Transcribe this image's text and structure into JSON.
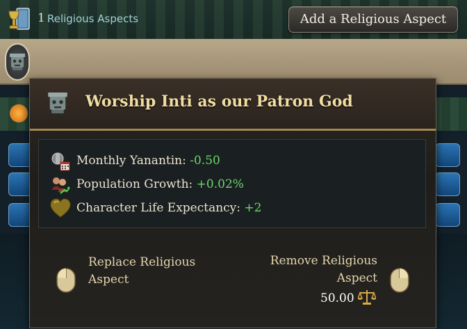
{
  "header": {
    "count": "1",
    "label": "Religious Aspects",
    "add_button": "Add a Religious Aspect",
    "icon": "chalice-book-icon"
  },
  "aspect_slot": {
    "icon": "inti-idol-icon"
  },
  "tooltip": {
    "icon": "inti-idol-icon",
    "title": "Worship Inti as our Patron God",
    "effects": [
      {
        "icon": "yanantin-calendar-icon",
        "label": "Monthly Yanantin",
        "sep": ": ",
        "value": "-0.50",
        "value_color": "#6fd66d"
      },
      {
        "icon": "population-growth-icon",
        "label": "Population Growth",
        "sep": ": ",
        "value": "+0.02%",
        "value_color": "#6fd66d"
      },
      {
        "icon": "heart-icon",
        "label": "Character Life Expectancy",
        "sep": ": ",
        "value": "+2",
        "value_color": "#6fd66d"
      }
    ],
    "left_action": {
      "line1": "Replace Religious",
      "line2": "Aspect",
      "icon": "mouse-left-click-icon"
    },
    "right_action": {
      "line1": "Remove Religious",
      "line2": "Aspect",
      "icon": "mouse-right-click-icon"
    },
    "cost": "50.00",
    "cost_icon": "scales-icon"
  },
  "colors": {
    "accent_gold": "#f1dda2",
    "positive": "#6fd66d",
    "link_blue": "#9fd3d6"
  }
}
